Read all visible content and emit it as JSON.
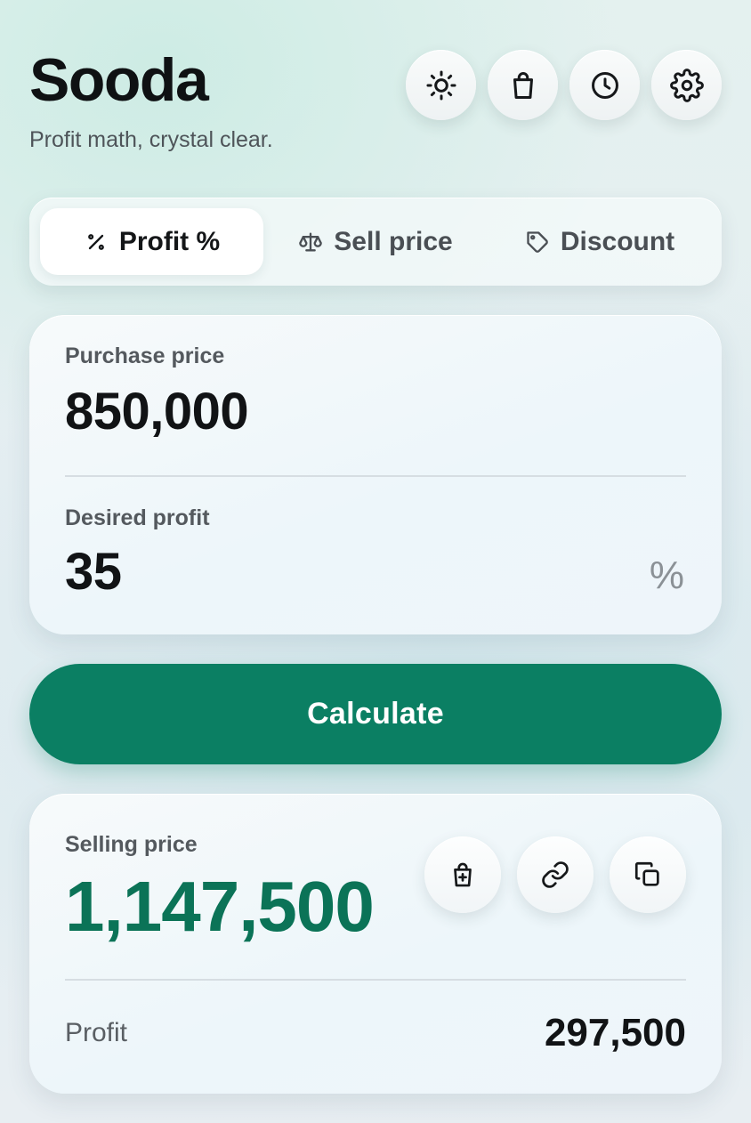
{
  "app": {
    "title": "Sooda",
    "tagline": "Profit math, crystal clear."
  },
  "header_actions": [
    {
      "name": "theme",
      "icon": "sun-icon"
    },
    {
      "name": "shop",
      "icon": "shopping-bag-icon"
    },
    {
      "name": "history",
      "icon": "clock-icon"
    },
    {
      "name": "settings",
      "icon": "gear-icon"
    }
  ],
  "tabs": [
    {
      "label": "Profit %",
      "icon": "percent-icon",
      "active": true
    },
    {
      "label": "Sell price",
      "icon": "scale-icon",
      "active": false
    },
    {
      "label": "Discount",
      "icon": "tag-icon",
      "active": false
    }
  ],
  "inputs": {
    "purchase_label": "Purchase price",
    "purchase_value": "850,000",
    "profit_label": "Desired profit",
    "profit_value": "35",
    "profit_suffix": "%"
  },
  "calculate_label": "Calculate",
  "result": {
    "selling_label": "Selling price",
    "selling_value": "1,147,500",
    "profit_label": "Profit",
    "profit_value": "297,500",
    "actions": [
      {
        "name": "add-to-bag",
        "icon": "bag-plus-icon"
      },
      {
        "name": "share-link",
        "icon": "link-icon"
      },
      {
        "name": "copy",
        "icon": "copy-icon"
      }
    ]
  },
  "colors": {
    "accent": "#0b7f63",
    "result_value": "#0b7357"
  }
}
